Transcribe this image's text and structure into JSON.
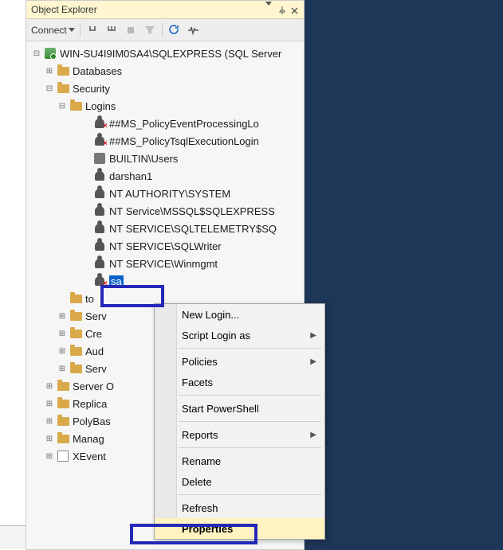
{
  "panel": {
    "title": "Object Explorer",
    "header_icons": {
      "dropdown": "dropdown-icon",
      "pin": "pin-icon",
      "close": "close-icon"
    }
  },
  "toolbar": {
    "connect_label": "Connect",
    "buttons": {
      "disconnect": "disconnect-icon",
      "disconnect_all": "disconnect-all-icon",
      "stop": "stop-icon",
      "filter": "filter-icon",
      "refresh": "refresh-icon",
      "activity": "activity-monitor-icon"
    }
  },
  "tree": {
    "server": "WIN-SU4I9IM0SA4\\SQLEXPRESS (SQL Server",
    "databases": "Databases",
    "security": "Security",
    "logins": "Logins",
    "login_items": [
      {
        "label": "##MS_PolicyEventProcessingLo",
        "disabled": true
      },
      {
        "label": "##MS_PolicyTsqlExecutionLogin",
        "disabled": true
      },
      {
        "label": "BUILTIN\\Users",
        "group": true
      },
      {
        "label": "darshan1"
      },
      {
        "label": "NT AUTHORITY\\SYSTEM"
      },
      {
        "label": "NT Service\\MSSQL$SQLEXPRESS"
      },
      {
        "label": "NT SERVICE\\SQLTELEMETRY$SQ"
      },
      {
        "label": "NT SERVICE\\SQLWriter"
      },
      {
        "label": "NT SERVICE\\Winmgmt"
      }
    ],
    "sa": "sa",
    "security_subfolders_trunc": [
      "to",
      "Serv",
      "Cre",
      "Aud",
      "Serv"
    ],
    "top_level_others": [
      "Server O",
      "Replica",
      "PolyBas",
      "Manag"
    ],
    "xevent": "XEvent"
  },
  "context_menu": {
    "items": [
      {
        "label": "New Login...",
        "key": "new-login"
      },
      {
        "label": "Script Login as",
        "key": "script-login-as",
        "submenu": true
      },
      {
        "sep": true
      },
      {
        "label": "Policies",
        "key": "policies",
        "submenu": true
      },
      {
        "label": "Facets",
        "key": "facets"
      },
      {
        "sep": true
      },
      {
        "label": "Start PowerShell",
        "key": "start-powershell"
      },
      {
        "sep": true
      },
      {
        "label": "Reports",
        "key": "reports",
        "submenu": true
      },
      {
        "sep": true
      },
      {
        "label": "Rename",
        "key": "rename"
      },
      {
        "label": "Delete",
        "key": "delete"
      },
      {
        "sep": true
      },
      {
        "label": "Refresh",
        "key": "refresh"
      },
      {
        "label": "Properties",
        "key": "properties",
        "highlight": true
      }
    ]
  }
}
